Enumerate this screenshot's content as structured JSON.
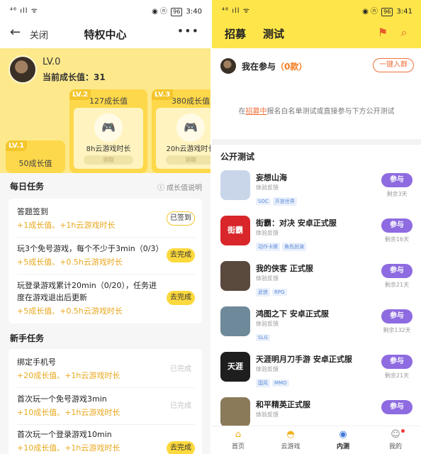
{
  "left": {
    "status": {
      "signal": "⁴⁶ ıll ᯤ",
      "right_icons": "◉ ⓝ",
      "battery": "96",
      "time": "3:40"
    },
    "header": {
      "back_icon": "arrow-left-icon",
      "close_label": "关闭",
      "title": "特权中心",
      "more_icon": "more-dots-icon"
    },
    "profile": {
      "level": "LV.0",
      "growth_label": "当前成长值：31"
    },
    "levels": [
      {
        "tag": "LV.1",
        "value": "50成长值",
        "desc": "",
        "claim": ""
      },
      {
        "tag": "LV.2",
        "value": "127成长值",
        "desc": "8h云游戏时长",
        "claim": "领取"
      },
      {
        "tag": "LV.3",
        "value": "380成长值",
        "desc": "20h云游戏时长",
        "claim": "领取"
      }
    ],
    "daily": {
      "title": "每日任务",
      "help": "成长值说明",
      "tasks": [
        {
          "title": "答题签到",
          "reward": "+1成长值、+1h云游戏时长",
          "button": "已签到",
          "state": "done"
        },
        {
          "title": "玩3个免号游戏，每个不少于3min（0/3）",
          "reward": "+5成长值、+0.5h云游戏时长",
          "button": "去完成",
          "state": "go"
        },
        {
          "title": "玩登录游戏累计20min（0/20），任务进度在游戏退出后更新",
          "reward": "+5成长值、+0.5h云游戏时长",
          "button": "去完成",
          "state": "go"
        }
      ]
    },
    "newbie": {
      "title": "新手任务",
      "tasks": [
        {
          "title": "绑定手机号",
          "reward": "+20成长值、+1h云游戏时长",
          "button": "已完成",
          "state": "grey"
        },
        {
          "title": "首次玩一个免号游戏3min",
          "reward": "+10成长值、+1h云游戏时长",
          "button": "已完成",
          "state": "grey"
        },
        {
          "title": "首次玩一个登录游戏10min",
          "reward": "+10成长值、+1h云游戏时长",
          "button": "去完成",
          "state": "go"
        }
      ]
    }
  },
  "right": {
    "status": {
      "signal": "⁴⁶ ıll ᯤ",
      "right_icons": "◉ ⓝ",
      "battery": "96",
      "time": "3:41"
    },
    "header": {
      "tab1": "招募",
      "tab2": "测试"
    },
    "participating": {
      "label": "我在参与",
      "count": "（0款）",
      "join_button": "一键入群",
      "hint_prefix": "在",
      "hint_link": "招募中",
      "hint_suffix": "报名白名单测试或直接参与下方公开测试"
    },
    "public_test": {
      "title": "公开测试",
      "games": [
        {
          "name": "妄想山海",
          "sub": "体验反馈",
          "tags": [
            "SOC",
            "开放世界"
          ],
          "button": "参与",
          "left": "剩余3天",
          "icon_color": "#c9d6ea",
          "icon_text": ""
        },
        {
          "name": "街霸：对决 安卓正式服",
          "sub": "体验反馈",
          "tags": [
            "动作卡牌",
            "角色扮演"
          ],
          "button": "参与",
          "left": "剩余16天",
          "icon_color": "#d8262a",
          "icon_text": "街霸"
        },
        {
          "name": "我的侠客 正式服",
          "sub": "体验反馈",
          "tags": [
            "武侠",
            "RPG"
          ],
          "button": "参与",
          "left": "剩余21天",
          "icon_color": "#5a4a3e",
          "icon_text": ""
        },
        {
          "name": "鸿图之下 安卓正式服",
          "sub": "体验反馈",
          "tags": [
            "SLG"
          ],
          "button": "参与",
          "left": "剩余132天",
          "icon_color": "#6e8a9a",
          "icon_text": ""
        },
        {
          "name": "天涯明月刀手游 安卓正式服",
          "sub": "体验反馈",
          "tags": [
            "国风",
            "MMO"
          ],
          "button": "参与",
          "left": "剩余21天",
          "icon_color": "#1e1e1e",
          "icon_text": "天涯"
        },
        {
          "name": "和平精英正式服",
          "sub": "体验反馈",
          "tags": [],
          "button": "参与",
          "left": "",
          "icon_color": "#8a7a5a",
          "icon_text": ""
        }
      ]
    },
    "tabbar": [
      {
        "label": "首页",
        "icon": "home-icon"
      },
      {
        "label": "云游戏",
        "icon": "gamepad-icon"
      },
      {
        "label": "内测",
        "icon": "eye-icon"
      },
      {
        "label": "我的",
        "icon": "profile-icon"
      }
    ]
  }
}
